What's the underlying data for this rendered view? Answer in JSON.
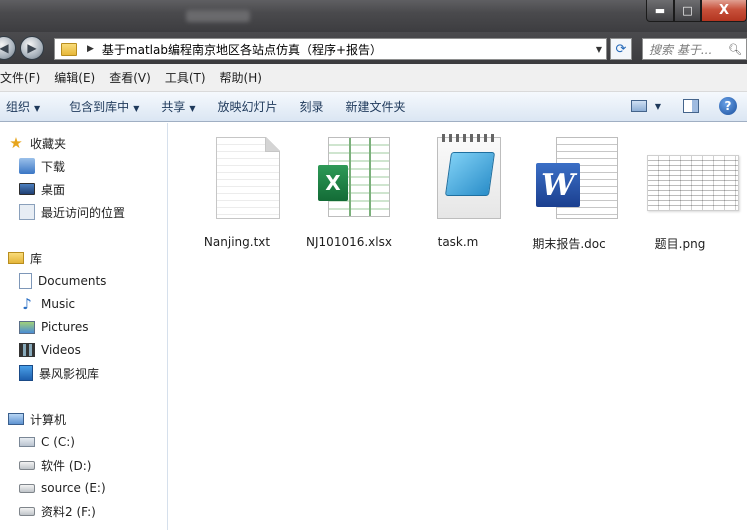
{
  "window": {
    "controls": {
      "minimize": "▬",
      "maximize": "□",
      "close": "X"
    }
  },
  "address": {
    "path": "基于matlab编程南京地区各站点仿真（程序+报告）",
    "search_placeholder": "搜索 基于..."
  },
  "menu": [
    "文件(F)",
    "编辑(E)",
    "查看(V)",
    "工具(T)",
    "帮助(H)"
  ],
  "commands": {
    "organize": "组织",
    "include_library": "包含到库中",
    "share": "共享",
    "slideshow": "放映幻灯片",
    "burn": "刻录",
    "new_folder": "新建文件夹"
  },
  "nav": {
    "favorites": {
      "label": "收藏夹",
      "items": [
        "下载",
        "桌面",
        "最近访问的位置"
      ]
    },
    "libraries": {
      "label": "库",
      "items": [
        "Documents",
        "Music",
        "Pictures",
        "Videos",
        "暴风影视库"
      ]
    },
    "computer": {
      "label": "计算机",
      "items": [
        "C (C:)",
        "软件 (D:)",
        "source (E:)",
        "资料2 (F:)"
      ]
    }
  },
  "files": [
    {
      "name": "Nanjing.txt",
      "icon": "text-file-icon"
    },
    {
      "name": "NJ101016.xlsx",
      "icon": "excel-file-icon"
    },
    {
      "name": "task.m",
      "icon": "matlab-file-icon"
    },
    {
      "name": "期末报告.doc",
      "icon": "word-file-icon"
    },
    {
      "name": "题目.png",
      "icon": "png-thumbnail"
    }
  ]
}
